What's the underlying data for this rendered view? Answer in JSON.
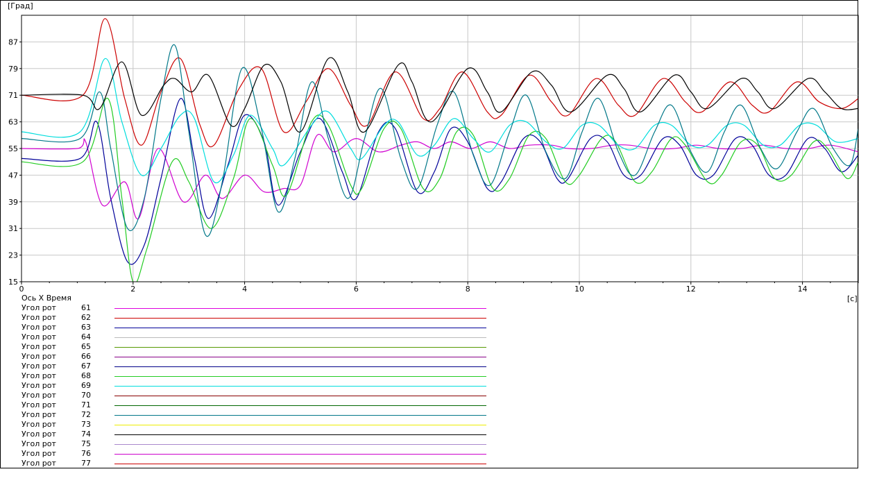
{
  "y_unit": "[Град]",
  "x_unit": "[с]",
  "x_axis_caption": "Ось X  Время",
  "chart_data": {
    "type": "line",
    "xlim": [
      0,
      15
    ],
    "ylim": [
      15,
      95
    ],
    "x_ticks": [
      0,
      2,
      4,
      6,
      8,
      10,
      12,
      14
    ],
    "y_ticks": [
      15,
      23,
      31,
      39,
      47,
      55,
      63,
      71,
      79,
      87
    ],
    "grid": true,
    "legend_position": "bottom-left",
    "xlabel": "[с]",
    "ylabel": "[Град]",
    "series": [
      {
        "name": "61",
        "color": "#d000d0",
        "points": [
          [
            0,
            55
          ],
          [
            1.0,
            55
          ],
          [
            1.15,
            57
          ],
          [
            1.45,
            38
          ],
          [
            1.85,
            45
          ],
          [
            2.1,
            34
          ],
          [
            2.45,
            55
          ],
          [
            2.9,
            39
          ],
          [
            3.3,
            47
          ],
          [
            3.6,
            40
          ],
          [
            4.0,
            47
          ],
          [
            4.35,
            42
          ],
          [
            4.7,
            43
          ],
          [
            5.0,
            44
          ],
          [
            5.3,
            59
          ],
          [
            5.6,
            54
          ],
          [
            6.0,
            58
          ],
          [
            6.4,
            54
          ],
          [
            6.8,
            56
          ],
          [
            7.1,
            57
          ],
          [
            7.4,
            55
          ],
          [
            7.7,
            57
          ],
          [
            8.05,
            55
          ],
          [
            8.4,
            57
          ],
          [
            8.75,
            55
          ],
          [
            9.1,
            56
          ],
          [
            9.5,
            56
          ],
          [
            9.8,
            55
          ],
          [
            10.2,
            55
          ],
          [
            10.6,
            56
          ],
          [
            10.9,
            56
          ],
          [
            11.3,
            55
          ],
          [
            11.7,
            55
          ],
          [
            12.1,
            56
          ],
          [
            12.5,
            55
          ],
          [
            12.9,
            55
          ],
          [
            13.3,
            56
          ],
          [
            13.7,
            55
          ],
          [
            14.1,
            55
          ],
          [
            14.5,
            56
          ],
          [
            15.0,
            54
          ]
        ]
      },
      {
        "name": "62",
        "color": "#cc0000",
        "points": [
          [
            0,
            71
          ],
          [
            1.1,
            71
          ],
          [
            1.5,
            94
          ],
          [
            1.85,
            70
          ],
          [
            2.15,
            56
          ],
          [
            2.5,
            72
          ],
          [
            2.85,
            82
          ],
          [
            3.2,
            62
          ],
          [
            3.45,
            56
          ],
          [
            3.9,
            73
          ],
          [
            4.3,
            79
          ],
          [
            4.7,
            60
          ],
          [
            5.1,
            69
          ],
          [
            5.5,
            79
          ],
          [
            5.9,
            68
          ],
          [
            6.2,
            62
          ],
          [
            6.7,
            78
          ],
          [
            7.2,
            64
          ],
          [
            7.5,
            67
          ],
          [
            7.9,
            78
          ],
          [
            8.35,
            66
          ],
          [
            8.6,
            65
          ],
          [
            9.1,
            77
          ],
          [
            9.5,
            69
          ],
          [
            9.8,
            65
          ],
          [
            10.3,
            76
          ],
          [
            10.7,
            68
          ],
          [
            11.0,
            65
          ],
          [
            11.5,
            76
          ],
          [
            11.9,
            69
          ],
          [
            12.2,
            66
          ],
          [
            12.7,
            75
          ],
          [
            13.1,
            68
          ],
          [
            13.4,
            66
          ],
          [
            13.9,
            75
          ],
          [
            14.3,
            69
          ],
          [
            14.7,
            67
          ],
          [
            15.0,
            70
          ]
        ]
      },
      {
        "name": "63",
        "color": "#000099",
        "points": [
          [
            0,
            52
          ],
          [
            1.05,
            52
          ],
          [
            1.35,
            63
          ],
          [
            1.6,
            40
          ],
          [
            1.9,
            21
          ],
          [
            2.2,
            26
          ],
          [
            2.5,
            46
          ],
          [
            2.85,
            70
          ],
          [
            3.1,
            52
          ],
          [
            3.35,
            34
          ],
          [
            3.7,
            50
          ],
          [
            4.0,
            65
          ],
          [
            4.35,
            57
          ],
          [
            4.6,
            38
          ],
          [
            5.0,
            54
          ],
          [
            5.35,
            64
          ],
          [
            5.75,
            48
          ],
          [
            6.0,
            40
          ],
          [
            6.4,
            60
          ],
          [
            6.7,
            61
          ],
          [
            7.1,
            42
          ],
          [
            7.4,
            48
          ],
          [
            7.7,
            61
          ],
          [
            8.0,
            57
          ],
          [
            8.35,
            43
          ],
          [
            8.6,
            45
          ],
          [
            9.0,
            58
          ],
          [
            9.3,
            57
          ],
          [
            9.6,
            46
          ],
          [
            9.8,
            46
          ],
          [
            10.2,
            58
          ],
          [
            10.5,
            57
          ],
          [
            10.8,
            47
          ],
          [
            11.1,
            47
          ],
          [
            11.5,
            58
          ],
          [
            11.8,
            56
          ],
          [
            12.1,
            47
          ],
          [
            12.4,
            47
          ],
          [
            12.8,
            58
          ],
          [
            13.1,
            56
          ],
          [
            13.4,
            47
          ],
          [
            13.7,
            47
          ],
          [
            14.1,
            58
          ],
          [
            14.4,
            55
          ],
          [
            14.7,
            48
          ],
          [
            15.0,
            53
          ]
        ]
      },
      {
        "name": "68",
        "color": "#22cc22",
        "points": [
          [
            0,
            51
          ],
          [
            1.1,
            51
          ],
          [
            1.55,
            70
          ],
          [
            1.8,
            40
          ],
          [
            2.0,
            15
          ],
          [
            2.25,
            25
          ],
          [
            2.7,
            51
          ],
          [
            3.0,
            45
          ],
          [
            3.4,
            31
          ],
          [
            3.8,
            46
          ],
          [
            4.1,
            64
          ],
          [
            4.5,
            50
          ],
          [
            4.75,
            41
          ],
          [
            5.2,
            63
          ],
          [
            5.5,
            62
          ],
          [
            5.9,
            44
          ],
          [
            6.1,
            43
          ],
          [
            6.5,
            61
          ],
          [
            6.8,
            61
          ],
          [
            7.2,
            43
          ],
          [
            7.5,
            46
          ],
          [
            7.8,
            60
          ],
          [
            8.1,
            59
          ],
          [
            8.45,
            43
          ],
          [
            8.75,
            46
          ],
          [
            9.1,
            59
          ],
          [
            9.4,
            58
          ],
          [
            9.75,
            45
          ],
          [
            10.0,
            47
          ],
          [
            10.4,
            58
          ],
          [
            10.65,
            57
          ],
          [
            11.0,
            45
          ],
          [
            11.3,
            48
          ],
          [
            11.65,
            58
          ],
          [
            11.9,
            56
          ],
          [
            12.3,
            45
          ],
          [
            12.55,
            47
          ],
          [
            12.9,
            57
          ],
          [
            13.2,
            56
          ],
          [
            13.5,
            46
          ],
          [
            13.8,
            47
          ],
          [
            14.2,
            57
          ],
          [
            14.45,
            55
          ],
          [
            14.8,
            46
          ],
          [
            15.0,
            51
          ]
        ]
      },
      {
        "name": "69",
        "color": "#00dddd",
        "points": [
          [
            0,
            60
          ],
          [
            1.05,
            60
          ],
          [
            1.5,
            82
          ],
          [
            1.8,
            63
          ],
          [
            2.15,
            47
          ],
          [
            2.5,
            55
          ],
          [
            2.85,
            65
          ],
          [
            3.1,
            64
          ],
          [
            3.45,
            45
          ],
          [
            3.8,
            53
          ],
          [
            4.1,
            65
          ],
          [
            4.5,
            55
          ],
          [
            4.7,
            50
          ],
          [
            5.2,
            62
          ],
          [
            5.5,
            66
          ],
          [
            5.9,
            55
          ],
          [
            6.1,
            52
          ],
          [
            6.5,
            62
          ],
          [
            6.75,
            63
          ],
          [
            7.1,
            53
          ],
          [
            7.4,
            56
          ],
          [
            7.75,
            64
          ],
          [
            8.1,
            58
          ],
          [
            8.4,
            54
          ],
          [
            8.75,
            62
          ],
          [
            9.05,
            63
          ],
          [
            9.4,
            57
          ],
          [
            9.7,
            55
          ],
          [
            10.05,
            62
          ],
          [
            10.35,
            62
          ],
          [
            10.7,
            56
          ],
          [
            11.0,
            55
          ],
          [
            11.35,
            62
          ],
          [
            11.65,
            62
          ],
          [
            12.0,
            56
          ],
          [
            12.3,
            56
          ],
          [
            12.65,
            62
          ],
          [
            12.95,
            62
          ],
          [
            13.3,
            56
          ],
          [
            13.6,
            56
          ],
          [
            13.95,
            62
          ],
          [
            14.25,
            62
          ],
          [
            14.6,
            57
          ],
          [
            15.0,
            58
          ]
        ]
      },
      {
        "name": "72",
        "color": "#007788",
        "points": [
          [
            0,
            58
          ],
          [
            1.05,
            58
          ],
          [
            1.4,
            72
          ],
          [
            1.6,
            55
          ],
          [
            1.9,
            31
          ],
          [
            2.2,
            40
          ],
          [
            2.5,
            70
          ],
          [
            2.75,
            86
          ],
          [
            3.0,
            60
          ],
          [
            3.3,
            29
          ],
          [
            3.6,
            45
          ],
          [
            3.95,
            79
          ],
          [
            4.3,
            61
          ],
          [
            4.6,
            36
          ],
          [
            4.9,
            52
          ],
          [
            5.2,
            75
          ],
          [
            5.5,
            58
          ],
          [
            5.85,
            40
          ],
          [
            6.15,
            58
          ],
          [
            6.45,
            73
          ],
          [
            6.8,
            52
          ],
          [
            7.1,
            43
          ],
          [
            7.45,
            62
          ],
          [
            7.75,
            72
          ],
          [
            8.1,
            53
          ],
          [
            8.4,
            44
          ],
          [
            8.75,
            60
          ],
          [
            9.05,
            71
          ],
          [
            9.4,
            54
          ],
          [
            9.75,
            46
          ],
          [
            10.05,
            60
          ],
          [
            10.35,
            70
          ],
          [
            10.7,
            54
          ],
          [
            11.0,
            47
          ],
          [
            11.35,
            60
          ],
          [
            11.65,
            68
          ],
          [
            12.0,
            54
          ],
          [
            12.3,
            48
          ],
          [
            12.6,
            60
          ],
          [
            12.9,
            68
          ],
          [
            13.25,
            55
          ],
          [
            13.55,
            49
          ],
          [
            13.9,
            60
          ],
          [
            14.2,
            67
          ],
          [
            14.55,
            55
          ],
          [
            14.85,
            50
          ],
          [
            15.0,
            61
          ]
        ]
      },
      {
        "name": "74",
        "color": "#000000",
        "points": [
          [
            0,
            71
          ],
          [
            1.1,
            71
          ],
          [
            1.4,
            67
          ],
          [
            1.8,
            81
          ],
          [
            2.15,
            65
          ],
          [
            2.55,
            74
          ],
          [
            2.75,
            76
          ],
          [
            3.05,
            72
          ],
          [
            3.35,
            77
          ],
          [
            3.75,
            62
          ],
          [
            4.0,
            67
          ],
          [
            4.35,
            80
          ],
          [
            4.65,
            75
          ],
          [
            5.0,
            60
          ],
          [
            5.5,
            82
          ],
          [
            5.85,
            72
          ],
          [
            6.15,
            60
          ],
          [
            6.75,
            80
          ],
          [
            7.0,
            75
          ],
          [
            7.35,
            63
          ],
          [
            8.0,
            79
          ],
          [
            8.35,
            72
          ],
          [
            8.6,
            66
          ],
          [
            9.15,
            78
          ],
          [
            9.5,
            74
          ],
          [
            9.85,
            66
          ],
          [
            10.5,
            77
          ],
          [
            10.8,
            73
          ],
          [
            11.1,
            66
          ],
          [
            11.7,
            77
          ],
          [
            12.0,
            72
          ],
          [
            12.3,
            67
          ],
          [
            12.9,
            76
          ],
          [
            13.2,
            72
          ],
          [
            13.5,
            67
          ],
          [
            14.1,
            76
          ],
          [
            14.4,
            72
          ],
          [
            14.7,
            67
          ],
          [
            15.0,
            67
          ]
        ]
      }
    ]
  },
  "legend": {
    "row_label": "Угол рот",
    "items": [
      {
        "num": "61",
        "color": "#dd00dd"
      },
      {
        "num": "62",
        "color": "#cc0000"
      },
      {
        "num": "63",
        "color": "#000099"
      },
      {
        "num": "64",
        "color": "#bbbbbb"
      },
      {
        "num": "65",
        "color": "#559900"
      },
      {
        "num": "66",
        "color": "#880088"
      },
      {
        "num": "67",
        "color": "#000088"
      },
      {
        "num": "68",
        "color": "#22cc22"
      },
      {
        "num": "69",
        "color": "#00dddd"
      },
      {
        "num": "70",
        "color": "#880000"
      },
      {
        "num": "71",
        "color": "#006600"
      },
      {
        "num": "72",
        "color": "#007788"
      },
      {
        "num": "73",
        "color": "#eeee00"
      },
      {
        "num": "74",
        "color": "#000000"
      },
      {
        "num": "75",
        "color": "#aa88cc"
      },
      {
        "num": "76",
        "color": "#cc00cc"
      },
      {
        "num": "77",
        "color": "#cc0000"
      }
    ]
  }
}
